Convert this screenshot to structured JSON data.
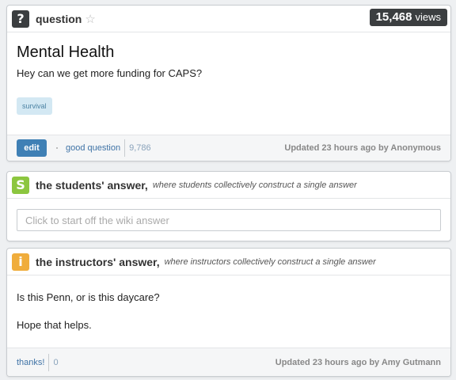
{
  "question": {
    "header_label": "question",
    "views_count": "15,468",
    "views_label": "views",
    "title": "Mental Health",
    "body": "Hey can we get more funding for CAPS?",
    "tag": "survival",
    "edit_label": "edit",
    "good_question_label": "good question",
    "good_question_count": "9,786",
    "updated_text": "Updated 23 hours ago by Anonymous"
  },
  "students_answer": {
    "icon_letter": "S",
    "title": "the students' answer,",
    "subtitle": "where students collectively construct a single answer",
    "placeholder": "Click to start off the wiki answer",
    "icon_color": "#8cc63f"
  },
  "instructors_answer": {
    "icon_letter": "i",
    "title": "the instructors' answer,",
    "subtitle": "where instructors collectively construct a single answer",
    "line1": "Is this Penn, or is this daycare?",
    "line2": "Hope that helps.",
    "thanks_label": "thanks!",
    "thanks_count": "0",
    "updated_text": "Updated 23 hours ago by Amy Gutmann",
    "icon_color": "#f0ad3c"
  },
  "icons": {
    "question_icon": "question-mark-icon",
    "favorite_icon": "star-icon",
    "student_icon": "student-s-icon",
    "instructor_icon": "instructor-i-icon"
  }
}
